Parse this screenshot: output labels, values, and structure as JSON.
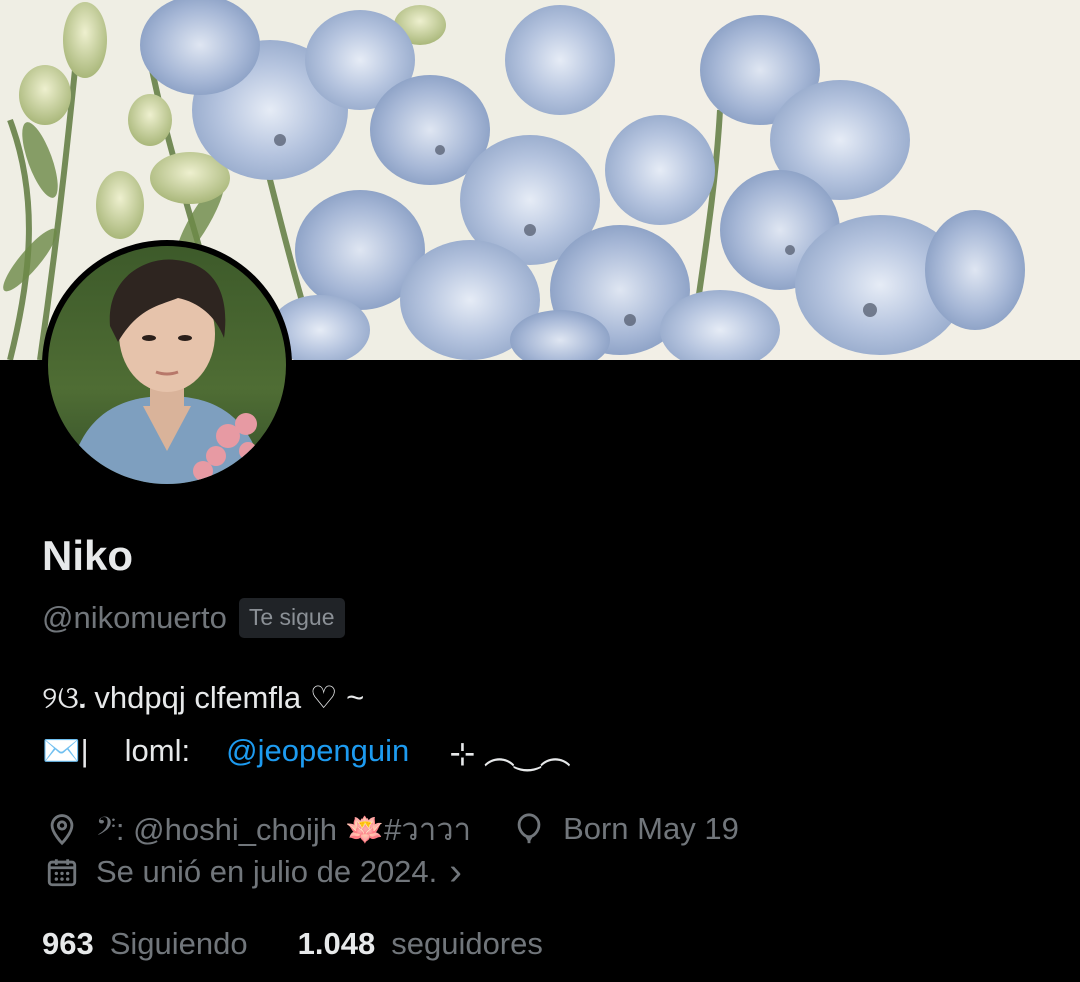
{
  "profile": {
    "name": "Niko",
    "handle": "@nikomuerto",
    "follows_you_badge": "Te sigue",
    "bio_line1": "୨ଓ᎐ vhdpqj clfemfla ♡ ~",
    "bio_line2_prefix": "✉️|",
    "bio_line2_label": "loml:",
    "bio_line2_mention": "@jeopenguin",
    "bio_line2_suffix": "⊹ ︵‿︵",
    "location": "𝄢: @hoshi_choijh 🪷#วาวา",
    "birthday": "Born May 19",
    "joined": "Se unió en julio de 2024.",
    "joined_chevron": "›"
  },
  "stats": {
    "following_count": "963",
    "following_label": "Siguiendo",
    "followers_count": "1.048",
    "followers_label": "seguidores"
  },
  "icons": {
    "location": "location-pin-icon",
    "birthday": "balloon-icon",
    "joined": "calendar-icon"
  },
  "colors": {
    "background": "#000000",
    "text_primary": "#e7e9ea",
    "text_secondary": "#71767b",
    "link": "#1d9bf0",
    "badge_bg": "#202327"
  }
}
